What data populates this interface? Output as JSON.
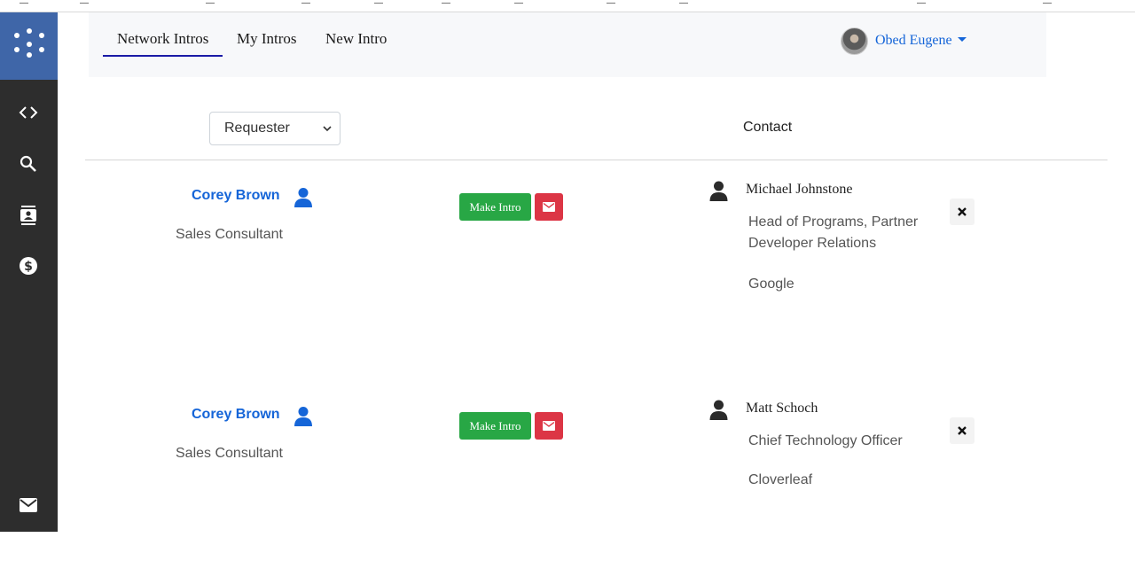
{
  "app": {
    "sidebar": {
      "logo_icon": "dots-logo-icon",
      "items": [
        {
          "icon": "code-icon"
        },
        {
          "icon": "search-icon"
        },
        {
          "icon": "contacts-icon"
        },
        {
          "icon": "dollar-icon"
        },
        {
          "icon": "mail-icon"
        }
      ]
    }
  },
  "header": {
    "tabs": [
      {
        "label": "Network Intros",
        "active": true
      },
      {
        "label": "My Intros",
        "active": false
      },
      {
        "label": "New Intro",
        "active": false
      }
    ],
    "user": {
      "name": "Obed Eugene"
    }
  },
  "filters": {
    "select_value": "Requester",
    "contact_header": "Contact"
  },
  "intros": [
    {
      "requester_name": "Corey Brown",
      "requester_title": "Sales Consultant",
      "make_intro_label": "Make Intro",
      "contact_name": "Michael Johnstone",
      "contact_title": "Head of Programs, Partner Developer Relations",
      "contact_company": "Google"
    },
    {
      "requester_name": "Corey Brown",
      "requester_title": "Sales Consultant",
      "make_intro_label": "Make Intro",
      "contact_name": "Matt Schoch",
      "contact_title": "Chief Technology Officer",
      "contact_company": "Cloverleaf"
    }
  ],
  "colors": {
    "sidebar_bg": "#2d2d2d",
    "logo_bg": "#3f66a8",
    "link_blue": "#1565d8",
    "success_green": "#28a745",
    "danger_red": "#dc3545"
  }
}
